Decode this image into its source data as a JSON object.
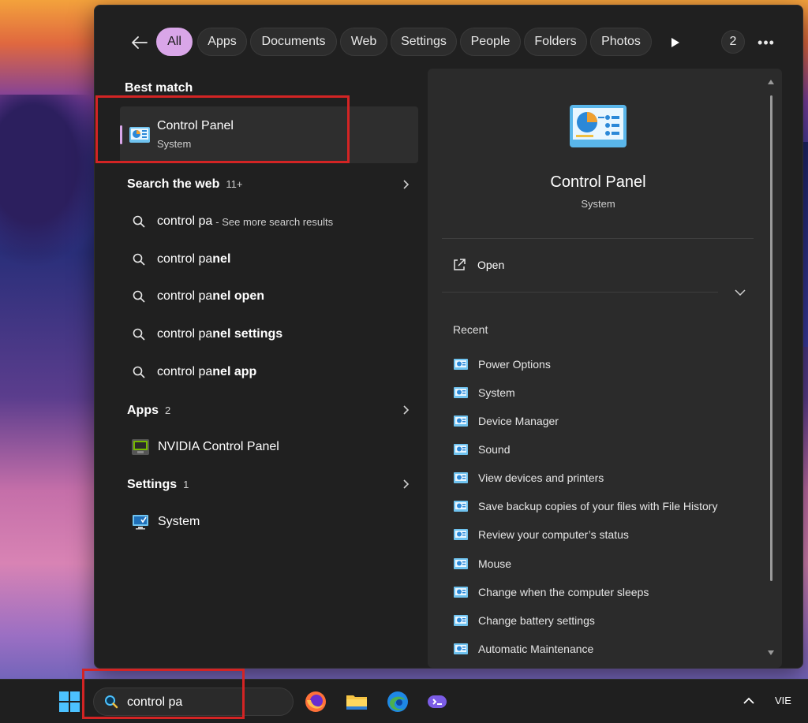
{
  "filters": {
    "tabs": [
      {
        "label": "All",
        "active": true
      },
      {
        "label": "Apps"
      },
      {
        "label": "Documents"
      },
      {
        "label": "Web"
      },
      {
        "label": "Settings"
      },
      {
        "label": "People"
      },
      {
        "label": "Folders"
      },
      {
        "label": "Photos"
      }
    ],
    "count_badge": "2",
    "more_label": "•••"
  },
  "left": {
    "best_match_title": "Best match",
    "best_match": {
      "title": "Control Panel",
      "subtitle": "System",
      "icon": "control-panel-icon"
    },
    "web_section": {
      "title": "Search the web",
      "count": "11+"
    },
    "web_results": [
      {
        "prefix": "control pa",
        "bold": "",
        "hint": "- See more search results"
      },
      {
        "prefix": "control pa",
        "bold": "nel",
        "hint": ""
      },
      {
        "prefix": "control pa",
        "bold": "nel open",
        "hint": ""
      },
      {
        "prefix": "control pa",
        "bold": "nel settings",
        "hint": ""
      },
      {
        "prefix": "control pa",
        "bold": "nel app",
        "hint": ""
      }
    ],
    "apps_section": {
      "title": "Apps",
      "count": "2"
    },
    "apps": [
      {
        "label": "NVIDIA Control Panel",
        "icon": "nvidia-icon"
      }
    ],
    "settings_section": {
      "title": "Settings",
      "count": "1"
    },
    "settings": [
      {
        "label": "System",
        "icon": "monitor-icon"
      }
    ]
  },
  "preview": {
    "title": "Control Panel",
    "subtitle": "System",
    "open_label": "Open",
    "recent_label": "Recent",
    "recent": [
      "Power Options",
      "System",
      "Device Manager",
      "Sound",
      "View devices and printers",
      "Save backup copies of your files with File History",
      "Review your computer’s status",
      "Mouse",
      "Change when the computer sleeps",
      "Change battery settings",
      "Automatic Maintenance"
    ]
  },
  "taskbar": {
    "search_text": "control pa",
    "apps": [
      "firefox-icon",
      "file-explorer-icon",
      "edge-icon",
      "copilot-icon"
    ],
    "language": "VIE"
  },
  "colors": {
    "accent": "#d9a6e8",
    "highlight": "#d32424",
    "panel": "#202020",
    "preview": "#2b2b2b"
  }
}
